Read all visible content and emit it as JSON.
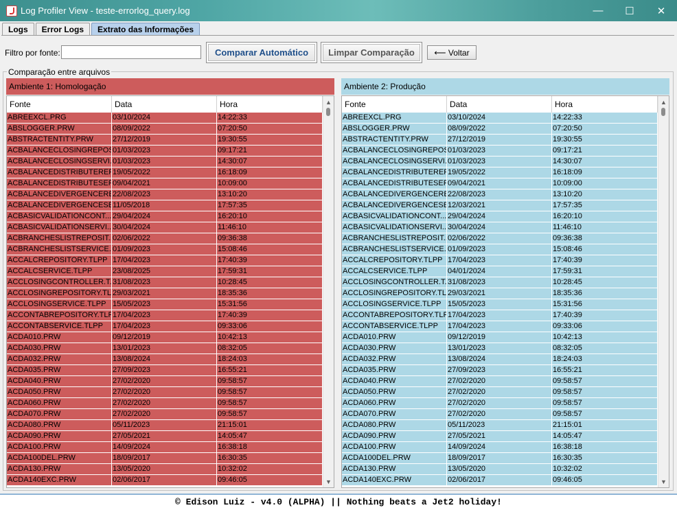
{
  "window": {
    "title": "Log Profiler View - teste-errorlog_query.log",
    "minimize": "—",
    "maximize": "☐",
    "close": "✕"
  },
  "tabs": [
    {
      "label": "Logs"
    },
    {
      "label": "Error Logs"
    },
    {
      "label": "Extrato das Informações"
    }
  ],
  "toolbar": {
    "filter_label": "Filtro por fonte:",
    "filter_value": "",
    "compare_auto": "Comparar Automático",
    "clear_compare": "Limpar Comparação",
    "back": "⟵ Voltar"
  },
  "comparison": {
    "legend": "Comparação entre arquivos",
    "columns": [
      "Fonte",
      "Data",
      "Hora"
    ],
    "left": {
      "title": "Ambiente 1: Homologação",
      "color": "#cd5c5c",
      "rows": [
        [
          "ABREEXCL.PRG",
          "03/10/2024",
          "14:22:33"
        ],
        [
          "ABSLOGGER.PRW",
          "08/09/2022",
          "07:20:50"
        ],
        [
          "ABSTRACTENTITY.PRW",
          "27/12/2019",
          "19:30:55"
        ],
        [
          "ACBALANCECLOSINGREPOS...",
          "01/03/2023",
          "09:17:21"
        ],
        [
          "ACBALANCECLOSINGSERVI...",
          "01/03/2023",
          "14:30:07"
        ],
        [
          "ACBALANCEDISTRIBUTEREP...",
          "19/05/2022",
          "16:18:09"
        ],
        [
          "ACBALANCEDISTRIBUTESER...",
          "09/04/2021",
          "10:09:00"
        ],
        [
          "ACBALANCEDIVERGENCERE...",
          "22/08/2023",
          "13:10:20"
        ],
        [
          "ACBALANCEDIVERGENCESE...",
          "11/05/2018",
          "17:57:35"
        ],
        [
          "ACBASICVALIDATIONCONT...",
          "29/04/2024",
          "16:20:10"
        ],
        [
          "ACBASICVALIDATIONSERVI...",
          "30/04/2024",
          "11:46:10"
        ],
        [
          "ACBRANCHESLISTREPOSIT...",
          "02/06/2022",
          "09:36:38"
        ],
        [
          "ACBRANCHESLISTSERVICE....",
          "01/09/2023",
          "15:08:46"
        ],
        [
          "ACCALCREPOSITORY.TLPP",
          "17/04/2023",
          "17:40:39"
        ],
        [
          "ACCALCSERVICE.TLPP",
          "23/08/2025",
          "17:59:31"
        ],
        [
          "ACCLOSINGCONTROLLER.T...",
          "31/08/2023",
          "10:28:45"
        ],
        [
          "ACCLOSINGREPOSITORY.TLPP",
          "29/03/2021",
          "18:35:36"
        ],
        [
          "ACCLOSINGSERVICE.TLPP",
          "15/05/2023",
          "15:31:56"
        ],
        [
          "ACCONTABREPOSITORY.TLPP",
          "17/04/2023",
          "17:40:39"
        ],
        [
          "ACCONTABSERVICE.TLPP",
          "17/04/2023",
          "09:33:06"
        ],
        [
          "ACDA010.PRW",
          "09/12/2019",
          "10:42:13"
        ],
        [
          "ACDA030.PRW",
          "13/01/2023",
          "08:32:05"
        ],
        [
          "ACDA032.PRW",
          "13/08/2024",
          "18:24:03"
        ],
        [
          "ACDA035.PRW",
          "27/09/2023",
          "16:55:21"
        ],
        [
          "ACDA040.PRW",
          "27/02/2020",
          "09:58:57"
        ],
        [
          "ACDA050.PRW",
          "27/02/2020",
          "09:58:57"
        ],
        [
          "ACDA060.PRW",
          "27/02/2020",
          "09:58:57"
        ],
        [
          "ACDA070.PRW",
          "27/02/2020",
          "09:58:57"
        ],
        [
          "ACDA080.PRW",
          "05/11/2023",
          "21:15:01"
        ],
        [
          "ACDA090.PRW",
          "27/05/2021",
          "14:05:47"
        ],
        [
          "ACDA100.PRW",
          "14/09/2024",
          "16:38:18"
        ],
        [
          "ACDA100DEL.PRW",
          "18/09/2017",
          "16:30:35"
        ],
        [
          "ACDA130.PRW",
          "13/05/2020",
          "10:32:02"
        ],
        [
          "ACDA140EXC.PRW",
          "02/06/2017",
          "09:46:05"
        ]
      ]
    },
    "right": {
      "title": "Ambiente 2: Produção",
      "color": "#add8e6",
      "rows": [
        [
          "ABREEXCL.PRG",
          "03/10/2024",
          "14:22:33"
        ],
        [
          "ABSLOGGER.PRW",
          "08/09/2022",
          "07:20:50"
        ],
        [
          "ABSTRACTENTITY.PRW",
          "27/12/2019",
          "19:30:55"
        ],
        [
          "ACBALANCECLOSINGREPOS...",
          "01/03/2023",
          "09:17:21"
        ],
        [
          "ACBALANCECLOSINGSERVI...",
          "01/03/2023",
          "14:30:07"
        ],
        [
          "ACBALANCEDISTRIBUTEREP...",
          "19/05/2022",
          "16:18:09"
        ],
        [
          "ACBALANCEDISTRIBUTESER...",
          "09/04/2021",
          "10:09:00"
        ],
        [
          "ACBALANCEDIVERGENCERE...",
          "22/08/2023",
          "13:10:20"
        ],
        [
          "ACBALANCEDIVERGENCESE...",
          "12/03/2021",
          "17:57:35"
        ],
        [
          "ACBASICVALIDATIONCONT...",
          "29/04/2024",
          "16:20:10"
        ],
        [
          "ACBASICVALIDATIONSERVI...",
          "30/04/2024",
          "11:46:10"
        ],
        [
          "ACBRANCHESLISTREPOSIT...",
          "02/06/2022",
          "09:36:38"
        ],
        [
          "ACBRANCHESLISTSERVICE....",
          "01/09/2023",
          "15:08:46"
        ],
        [
          "ACCALCREPOSITORY.TLPP",
          "17/04/2023",
          "17:40:39"
        ],
        [
          "ACCALCSERVICE.TLPP",
          "04/01/2024",
          "17:59:31"
        ],
        [
          "ACCLOSINGCONTROLLER.T...",
          "31/08/2023",
          "10:28:45"
        ],
        [
          "ACCLOSINGREPOSITORY.TLPP",
          "29/03/2021",
          "18:35:36"
        ],
        [
          "ACCLOSINGSERVICE.TLPP",
          "15/05/2023",
          "15:31:56"
        ],
        [
          "ACCONTABREPOSITORY.TLPP",
          "17/04/2023",
          "17:40:39"
        ],
        [
          "ACCONTABSERVICE.TLPP",
          "17/04/2023",
          "09:33:06"
        ],
        [
          "ACDA010.PRW",
          "09/12/2019",
          "10:42:13"
        ],
        [
          "ACDA030.PRW",
          "13/01/2023",
          "08:32:05"
        ],
        [
          "ACDA032.PRW",
          "13/08/2024",
          "18:24:03"
        ],
        [
          "ACDA035.PRW",
          "27/09/2023",
          "16:55:21"
        ],
        [
          "ACDA040.PRW",
          "27/02/2020",
          "09:58:57"
        ],
        [
          "ACDA050.PRW",
          "27/02/2020",
          "09:58:57"
        ],
        [
          "ACDA060.PRW",
          "27/02/2020",
          "09:58:57"
        ],
        [
          "ACDA070.PRW",
          "27/02/2020",
          "09:58:57"
        ],
        [
          "ACDA080.PRW",
          "05/11/2023",
          "21:15:01"
        ],
        [
          "ACDA090.PRW",
          "27/05/2021",
          "14:05:47"
        ],
        [
          "ACDA100.PRW",
          "14/09/2024",
          "16:38:18"
        ],
        [
          "ACDA100DEL.PRW",
          "18/09/2017",
          "16:30:35"
        ],
        [
          "ACDA130.PRW",
          "13/05/2020",
          "10:32:02"
        ],
        [
          "ACDA140EXC.PRW",
          "02/06/2017",
          "09:46:05"
        ]
      ]
    }
  },
  "footer": {
    "text": "© Edison Luiz - v4.0 (ALPHA)   ||   Nothing beats a Jet2 holiday!"
  }
}
